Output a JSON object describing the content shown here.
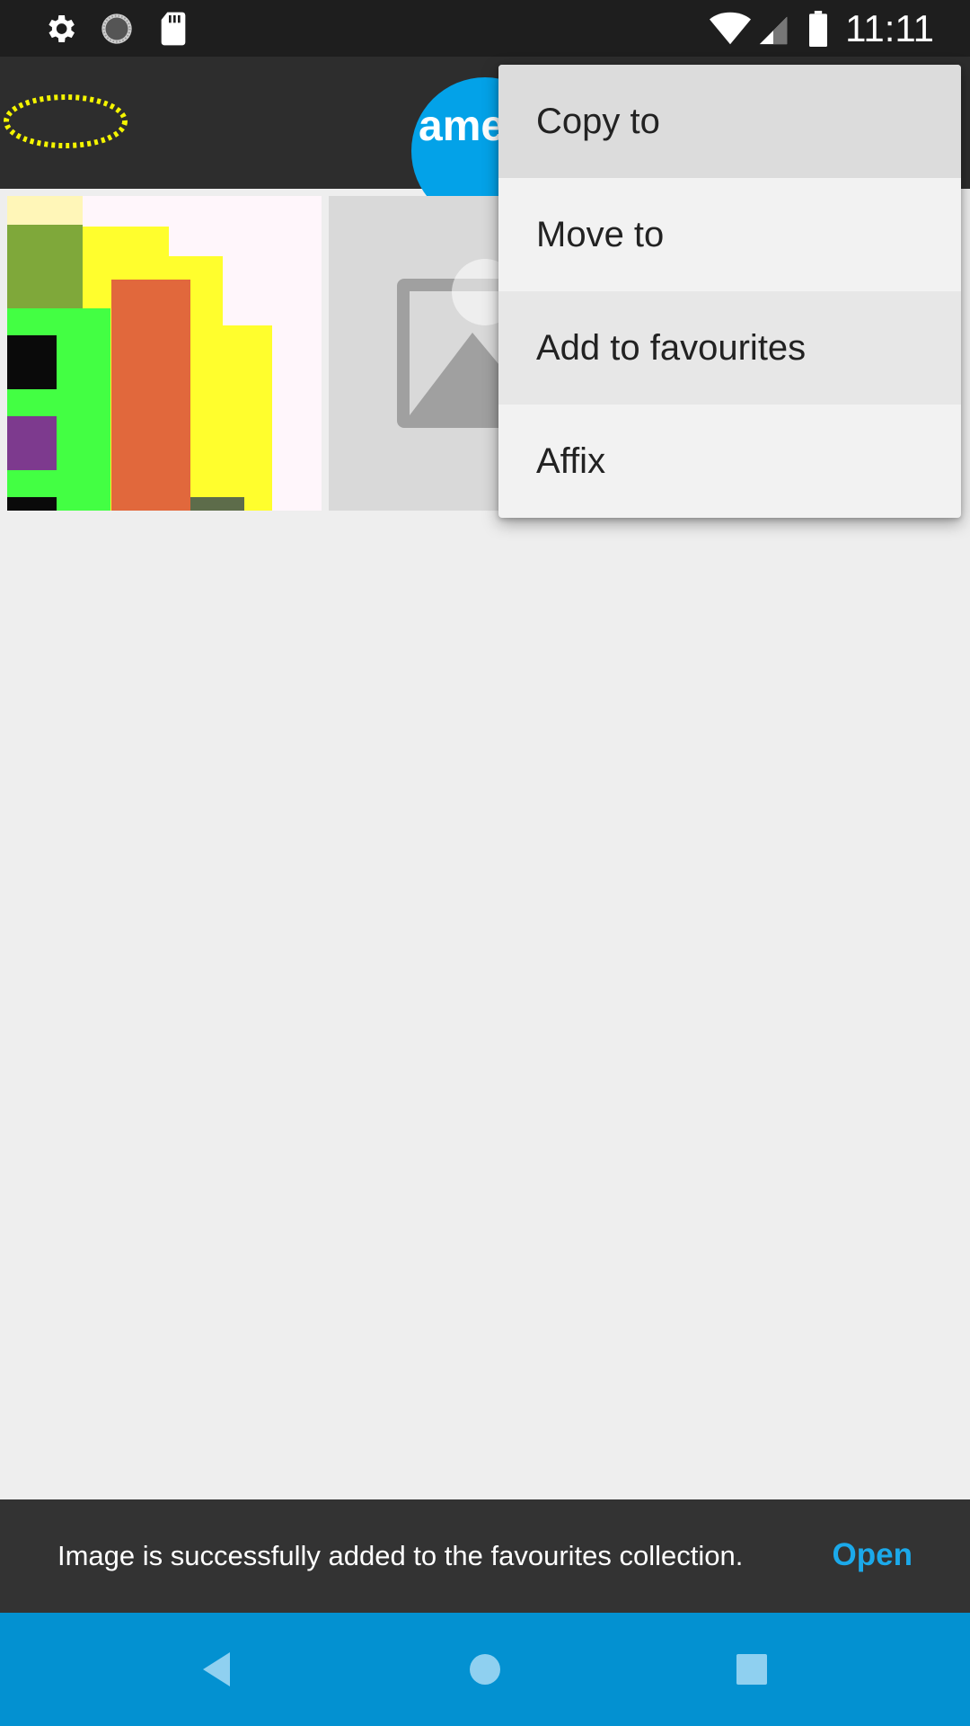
{
  "status_bar": {
    "time": "11:11",
    "icons": [
      "gear-icon",
      "spinner-icon",
      "sd-card-icon",
      "wifi-icon",
      "cell-signal-icon",
      "battery-icon"
    ]
  },
  "app_bar": {
    "title": "amera"
  },
  "popup_menu": {
    "items": [
      {
        "label": "Copy to"
      },
      {
        "label": "Move to"
      },
      {
        "label": "Add to favourites"
      },
      {
        "label": "Affix"
      }
    ]
  },
  "snackbar": {
    "message": "Image is successfully added to the favourites collection.",
    "action": "Open"
  },
  "colors": {
    "accent": "#03a2e8",
    "nav_bar": "#0391d1",
    "snackbar_action": "#1ba9ea"
  }
}
